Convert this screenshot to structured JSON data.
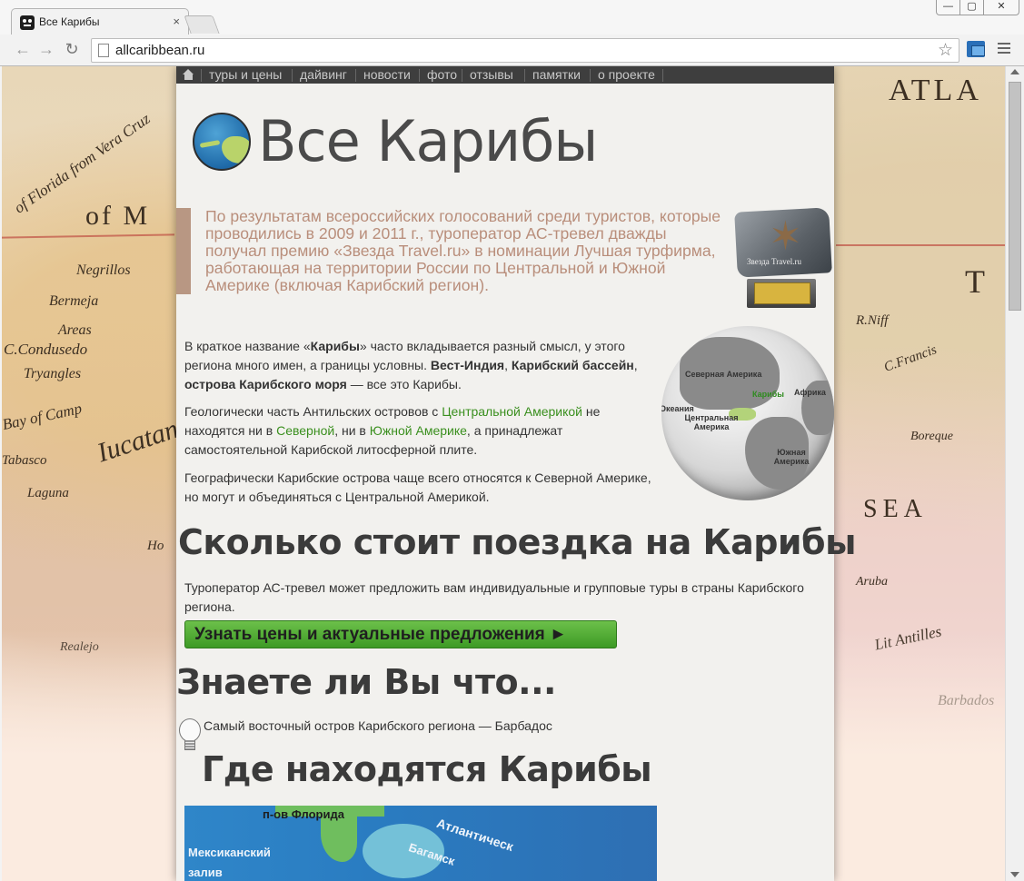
{
  "browser": {
    "tab_title": "Все Карибы",
    "tab_close": "×",
    "url": "allcaribbean.ru",
    "back_glyph": "←",
    "forward_glyph": "→",
    "reload_glyph": "↻",
    "star_glyph": "☆",
    "window_min": "—",
    "window_max": "▢",
    "window_close": "✕"
  },
  "nav": {
    "items": [
      "туры и цены",
      "дайвинг",
      "новости",
      "фото",
      "отзывы",
      "памятки",
      "о проекте"
    ]
  },
  "header": {
    "title": "Все Карибы"
  },
  "award": {
    "text": "По результатам всероссийских голосований среди туристов, которые проводились в 2009 и 2011 г., туроператор АС-тревел дважды получал премию «Звезда Travel.ru» в номинации Лучшая турфирма, работающая на территории России по Центральной и Южной Америке (включая Карибский регион).",
    "image_label": "Звезда Travel.ru"
  },
  "intro": {
    "p1_a": "В краткое название «",
    "p1_b": "Карибы",
    "p1_c": "» часто вкладывается разный смысл, у этого региона много имен, а границы условны. ",
    "p1_d": "Вест-Индия",
    "p1_e": ", ",
    "p1_f": "Карибский бассейн",
    "p1_g": ", ",
    "p1_h": "острова Карибского моря",
    "p1_i": " — все это Карибы.",
    "p2_a": "Геологически часть Антильских островов с ",
    "p2_link1": "Центральной Америкой",
    "p2_b": " не находятся ни в ",
    "p2_link2": "Северной",
    "p2_c": ", ни в ",
    "p2_link3": "Южной Америке",
    "p2_d": ", а принадлежат самостоятельной Карибской литосферной плите.",
    "p3": "Географически Карибские острова чаще всего относятся к Северной Америке, но могут и объединяться с Центральной Америкой."
  },
  "globe": {
    "north_america": "Северная Америка",
    "caribbean": "Карибы",
    "africa": "Африка",
    "oceania": "Океания",
    "central_america": "Центральная Америка",
    "south_america": "Южная Америка"
  },
  "cost": {
    "heading": "Сколько стоит поездка на Карибы",
    "text": "Туроператор АС-тревел может предложить вам индивидуальные и групповые туры в страны Карибского региона.",
    "button": "Узнать цены и актуальные предложения ►"
  },
  "facts": {
    "heading": "Знаете ли Вы что...",
    "item": "Самый восточный остров Карибского региона — Барбадос"
  },
  "location": {
    "heading": "Где находятся Карибы",
    "map_florida": "п-ов Флорида",
    "map_mexican": "Мексиканский",
    "map_gulf": "залив",
    "map_atlantic": "Атлантическ",
    "map_bahamas": "Багамск"
  },
  "background_map": {
    "labels": [
      "ATLA",
      "of Florida from Vera Cruz",
      "of M",
      "Negrillos",
      "Bermeja",
      "Areas",
      "C.Condusedo",
      "Tryangles",
      "Bay of Camp",
      "Iucatan",
      "Laguna",
      "Tabasco",
      "Ho",
      "Realejo",
      "T",
      "R.Niff",
      "C.Francis",
      "Boreque",
      "SEA",
      "Aruba",
      "Lit Antilles",
      "Barbados"
    ]
  }
}
